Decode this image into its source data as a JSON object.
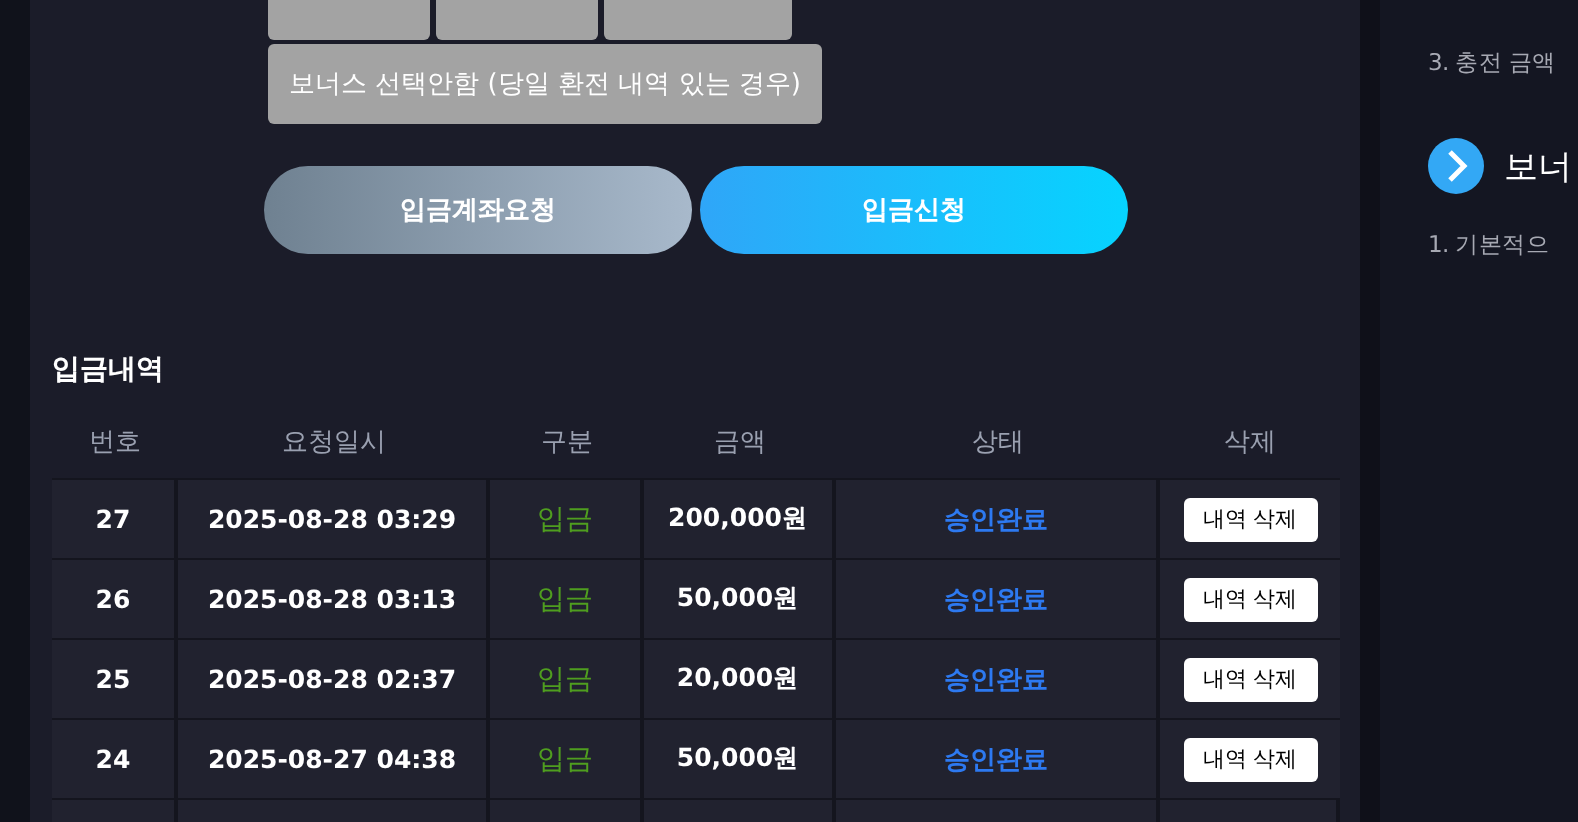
{
  "game_buttons": [
    {
      "selected": false
    },
    {
      "selected": false
    },
    {
      "selected": false
    }
  ],
  "bonus_option": {
    "label": "보너스 선택안함 (당일 환전 내역 있는 경우)",
    "selected": false
  },
  "actions": [
    {
      "label": "입금계좌요청",
      "kind": "secondary"
    },
    {
      "label": "입금신청",
      "kind": "primary"
    }
  ],
  "history": {
    "title": "입금내역",
    "columns": [
      "번호",
      "요청일시",
      "구분",
      "금액",
      "상태",
      "삭제"
    ],
    "rows": [
      {
        "no": "27",
        "date": "2025-08-28 03:29",
        "type": "입금",
        "amount": "200,000원",
        "status": "승인완료",
        "action": "내역 삭제"
      },
      {
        "no": "26",
        "date": "2025-08-28 03:13",
        "type": "입금",
        "amount": "50,000원",
        "status": "승인완료",
        "action": "내역 삭제"
      },
      {
        "no": "25",
        "date": "2025-08-28 02:37",
        "type": "입금",
        "amount": "20,000원",
        "status": "승인완료",
        "action": "내역 삭제"
      },
      {
        "no": "24",
        "date": "2025-08-27 04:38",
        "type": "입금",
        "amount": "50,000원",
        "status": "승인완료",
        "action": "내역 삭제"
      }
    ]
  },
  "side": {
    "note": "3. 충전 금액",
    "heading": "보너",
    "line": "1. 기본적으"
  }
}
